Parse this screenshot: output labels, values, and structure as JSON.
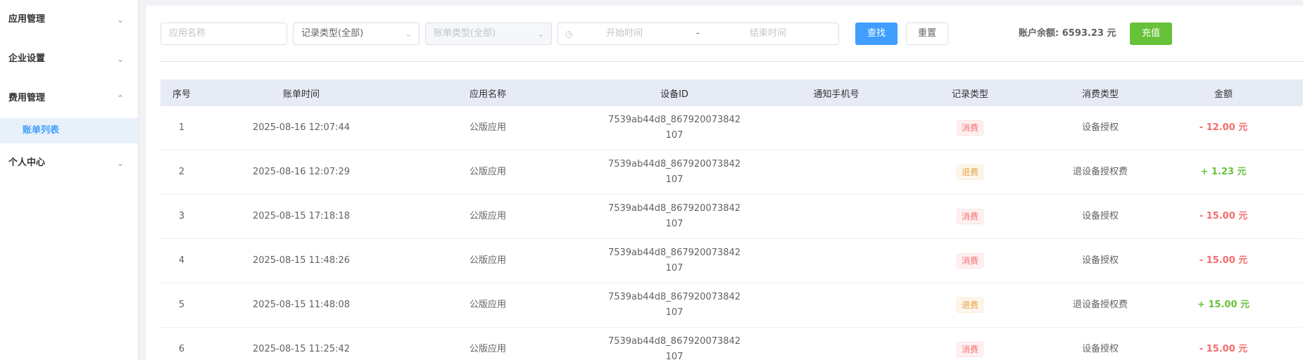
{
  "sidebar": {
    "groups": [
      {
        "title": "应用管理",
        "chevron": "chevron-down-icon"
      },
      {
        "title": "企业设置",
        "chevron": "chevron-down-icon"
      },
      {
        "title": "费用管理",
        "chevron": "chevron-up-icon",
        "active_child": "账单列表"
      },
      {
        "title": "个人中心",
        "chevron": "chevron-down-icon"
      }
    ]
  },
  "filters": {
    "app_name_placeholder": "应用名称",
    "record_type_value": "记录类型(全部)",
    "bill_type_value": "账单类型(全部)",
    "date_start_placeholder": "开始时间",
    "date_separator": "-",
    "date_end_placeholder": "结束时间",
    "search_label": "查找",
    "reset_label": "重置",
    "balance_label": "账户余额:",
    "balance_value": "6593.23 元",
    "recharge_label": "充值"
  },
  "table": {
    "headers": [
      "序号",
      "账单时间",
      "应用名称",
      "设备ID",
      "通知手机号",
      "记录类型",
      "消费类型",
      "金额"
    ],
    "rows": [
      {
        "no": "1",
        "time": "2025-08-16 12:07:44",
        "app": "公版应用",
        "device_line1": "7539ab44d8_867920073842",
        "device_line2": "107",
        "phone": "",
        "record": "消费",
        "record_kind": "danger",
        "type": "设备授权",
        "amount": "- 12.00 元",
        "amount_sign": "neg"
      },
      {
        "no": "2",
        "time": "2025-08-16 12:07:29",
        "app": "公版应用",
        "device_line1": "7539ab44d8_867920073842",
        "device_line2": "107",
        "phone": "",
        "record": "退费",
        "record_kind": "warning",
        "type": "退设备授权费",
        "amount": "+ 1.23 元",
        "amount_sign": "pos"
      },
      {
        "no": "3",
        "time": "2025-08-15 17:18:18",
        "app": "公版应用",
        "device_line1": "7539ab44d8_867920073842",
        "device_line2": "107",
        "phone": "",
        "record": "消费",
        "record_kind": "danger",
        "type": "设备授权",
        "amount": "- 15.00 元",
        "amount_sign": "neg"
      },
      {
        "no": "4",
        "time": "2025-08-15 11:48:26",
        "app": "公版应用",
        "device_line1": "7539ab44d8_867920073842",
        "device_line2": "107",
        "phone": "",
        "record": "消费",
        "record_kind": "danger",
        "type": "设备授权",
        "amount": "- 15.00 元",
        "amount_sign": "neg"
      },
      {
        "no": "5",
        "time": "2025-08-15 11:48:08",
        "app": "公版应用",
        "device_line1": "7539ab44d8_867920073842",
        "device_line2": "107",
        "phone": "",
        "record": "退费",
        "record_kind": "warning",
        "type": "退设备授权费",
        "amount": "+ 15.00 元",
        "amount_sign": "pos"
      },
      {
        "no": "6",
        "time": "2025-08-15 11:25:42",
        "app": "公版应用",
        "device_line1": "7539ab44d8_867920073842",
        "device_line2": "107",
        "phone": "",
        "record": "消费",
        "record_kind": "danger",
        "type": "设备授权",
        "amount": "- 15.00 元",
        "amount_sign": "neg"
      }
    ]
  },
  "colors": {
    "primary": "#409eff",
    "success": "#67c23a",
    "danger": "#f56c6c",
    "warning": "#e6a23c"
  }
}
